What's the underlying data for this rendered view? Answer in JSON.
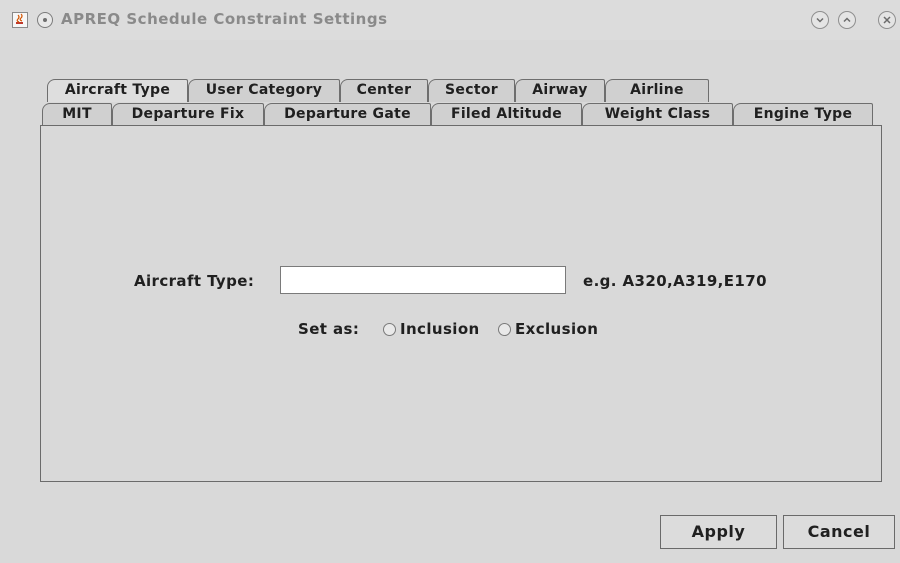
{
  "window": {
    "title": "APREQ Schedule Constraint Settings",
    "app_icon": "java-cup-icon",
    "controls": [
      "minimize-icon",
      "maximize-icon",
      "close-icon"
    ]
  },
  "tabs": {
    "row_back": [
      "Aircraft Type",
      "User Category",
      "Center",
      "Sector",
      "Airway",
      "Airline"
    ],
    "row_front": [
      "MIT",
      "Departure Fix",
      "Departure Gate",
      "Filed Altitude",
      "Weight Class",
      "Engine Type"
    ],
    "selected": "Aircraft Type"
  },
  "form": {
    "aircraft_type_label": "Aircraft Type:",
    "aircraft_type_value": "",
    "aircraft_type_hint": "e.g. A320,A319,E170",
    "set_as_label": "Set as:",
    "options": [
      "Inclusion",
      "Exclusion"
    ],
    "selected_option": ""
  },
  "buttons": {
    "apply": "Apply",
    "cancel": "Cancel"
  }
}
